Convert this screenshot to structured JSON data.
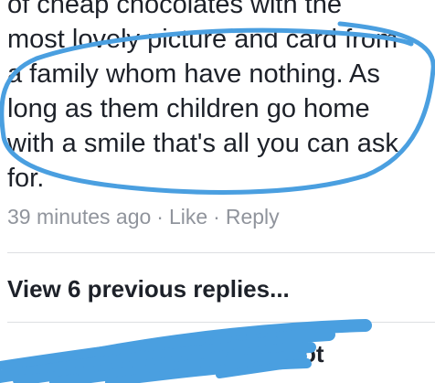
{
  "comment": {
    "lines": [
      "of cheap chocolates with the",
      "most lovely picture and card from",
      "a family whom have nothing. As",
      "long as them children go home",
      "with a smile that's all you can ask",
      "for."
    ],
    "timestamp": "39 minutes ago",
    "separator": "·",
    "like_label": "Like",
    "reply_label": "Reply"
  },
  "replies": {
    "view_previous_label": "View 6 previous replies..."
  },
  "next_comment": {
    "visible_text": "ot"
  },
  "annotation": {
    "color": "#4a9fe0"
  }
}
